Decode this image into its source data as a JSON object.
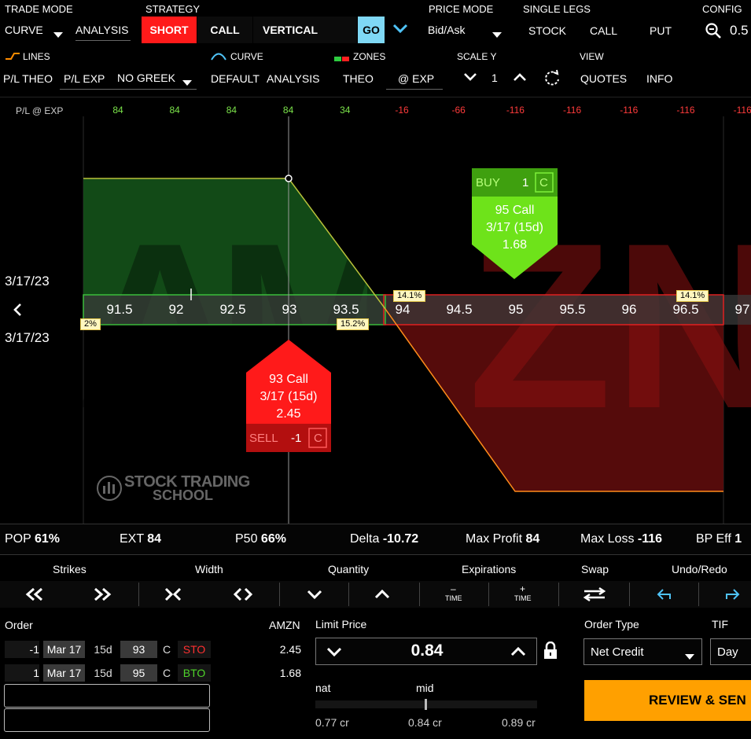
{
  "top": {
    "trade_mode_label": "TRADE MODE",
    "trade_mode_value": "CURVE",
    "analysis_label": "ANALYSIS",
    "strategy_label": "STRATEGY",
    "strategy_short": "SHORT",
    "strategy_call": "CALL",
    "strategy_vertical": "VERTICAL",
    "go_label": "GO",
    "price_mode_label": "PRICE MODE",
    "price_mode_value": "Bid/Ask",
    "single_legs_label": "SINGLE LEGS",
    "stock_label": "STOCK",
    "call_label": "CALL",
    "put_label": "PUT",
    "config_label": "CONFIG",
    "config_value": "0.5"
  },
  "second": {
    "lines_label": "LINES",
    "curve_label": "CURVE",
    "zones_label": "ZONES",
    "scale_y_label": "SCALE Y",
    "view_label": "VIEW",
    "pl_theo": "P/L THEO",
    "pl_exp": "P/L EXP",
    "no_greek": "NO GREEK",
    "default": "DEFAULT",
    "analysis": "ANALYSIS",
    "theo": "THEO",
    "at_exp": "@ EXP",
    "scale_value": "1",
    "quotes": "QUOTES",
    "info": "INFO"
  },
  "pl_row": {
    "label": "P/L @ EXP",
    "values": [
      "84",
      "84",
      "84",
      "84",
      "34",
      "-16",
      "-66",
      "-116",
      "-116",
      "-116",
      "-116",
      "-116"
    ]
  },
  "chart": {
    "date_top": "3/17/23",
    "date_bottom": "3/17/23",
    "strikes": [
      "91.5",
      "92",
      "92.5",
      "93",
      "93.5",
      "94",
      "94.5",
      "95",
      "95.5",
      "96",
      "96.5",
      "97"
    ],
    "pct_left": "2%",
    "pct_mid": "15.2%",
    "pct_r1": "14.1%",
    "pct_r2": "14.1%",
    "buy_card": {
      "action": "BUY",
      "qty": "1",
      "type": "C",
      "line1": "95 Call",
      "line2": "3/17 (15d)",
      "line3": "1.68"
    },
    "sell_card": {
      "action": "SELL",
      "qty": "-1",
      "type": "C",
      "line1": "93 Call",
      "line2": "3/17 (15d)",
      "line3": "2.45"
    },
    "watermark_line1": "STOCK TRADING",
    "watermark_line2": "SCHOOL",
    "bg_letters": "AMZN",
    "colors": {
      "profit": "#1e6b1e",
      "loss": "#6b0e0e",
      "buy": "#6ee31a",
      "sell": "#ff1a1a"
    }
  },
  "stats": {
    "pop_label": "POP",
    "pop": "61%",
    "ext_label": "EXT",
    "ext": "84",
    "p50_label": "P50",
    "p50": "66%",
    "delta_label": "Delta",
    "delta": "-10.72",
    "maxp_label": "Max Profit",
    "maxp": "84",
    "maxl_label": "Max Loss",
    "maxl": "-116",
    "bp_label": "BP Eff",
    "bp": "1"
  },
  "controls": {
    "strikes": "Strikes",
    "width": "Width",
    "quantity": "Quantity",
    "expirations": "Expirations",
    "swap": "Swap",
    "undo_redo": "Undo/Redo",
    "time": "TIME"
  },
  "order": {
    "order_label": "Order",
    "symbol": "AMZN",
    "legs": [
      {
        "qty": "-1",
        "exp": "Mar 17",
        "dte": "15d",
        "strike": "93",
        "type": "C",
        "action": "STO",
        "price": "2.45"
      },
      {
        "qty": "1",
        "exp": "Mar 17",
        "dte": "15d",
        "strike": "95",
        "type": "C",
        "action": "BTO",
        "price": "1.68"
      }
    ],
    "limit_label": "Limit Price",
    "limit_value": "0.84",
    "nat_label": "nat",
    "mid_label": "mid",
    "nat_value": "0.77 cr",
    "mid_value": "0.84 cr",
    "far_value": "0.89 cr",
    "order_type_label": "Order Type",
    "order_type_value": "Net Credit",
    "tif_label": "TIF",
    "tif_value": "Day",
    "review_button": "REVIEW & SEN"
  }
}
